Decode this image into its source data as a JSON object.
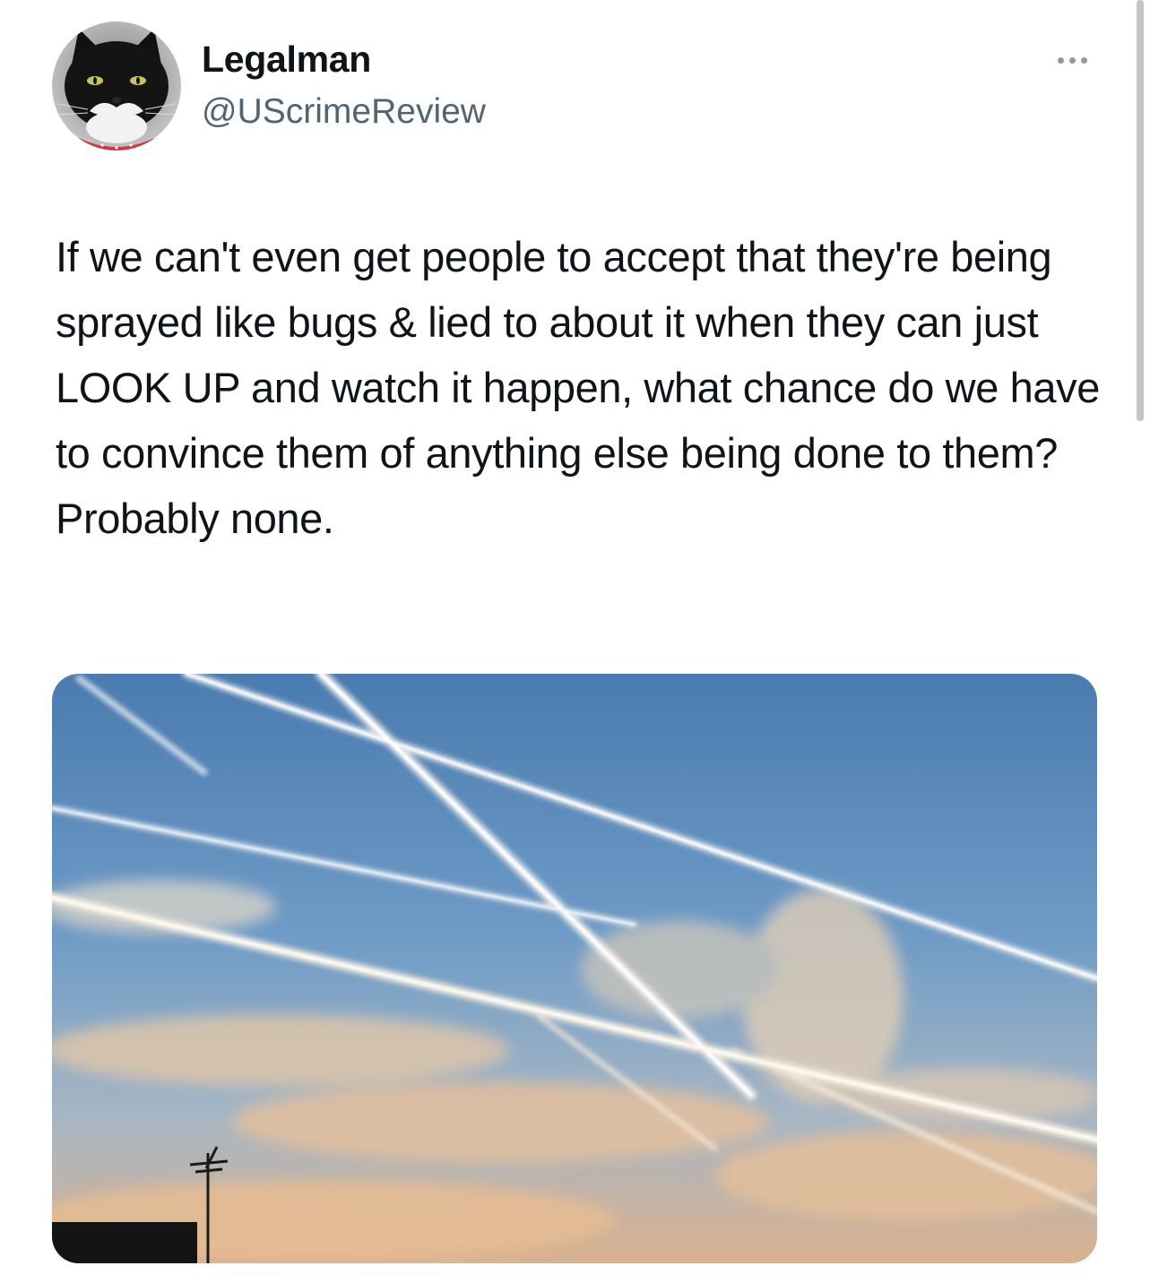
{
  "author": {
    "display_name": "Legalman",
    "handle": "@UScrimeReview"
  },
  "avatar": {
    "icon": "cat-avatar-icon"
  },
  "more_icon": "more-horizontal-icon",
  "tweet": {
    "text": "If we can't even get people to accept that they're being sprayed like bugs & lied to about it when they can just LOOK UP and watch it happen, what chance do we have to convince them of anything else being done to them? Probably none."
  },
  "media": {
    "subject": "sky with crossing contrails over a rooftop antenna"
  },
  "colors": {
    "text": "#0f1419",
    "secondary_text": "#536471",
    "icon": "#8b98a5",
    "sky_top": "#4f7eb0",
    "sky_bottom": "#d9b89a"
  }
}
